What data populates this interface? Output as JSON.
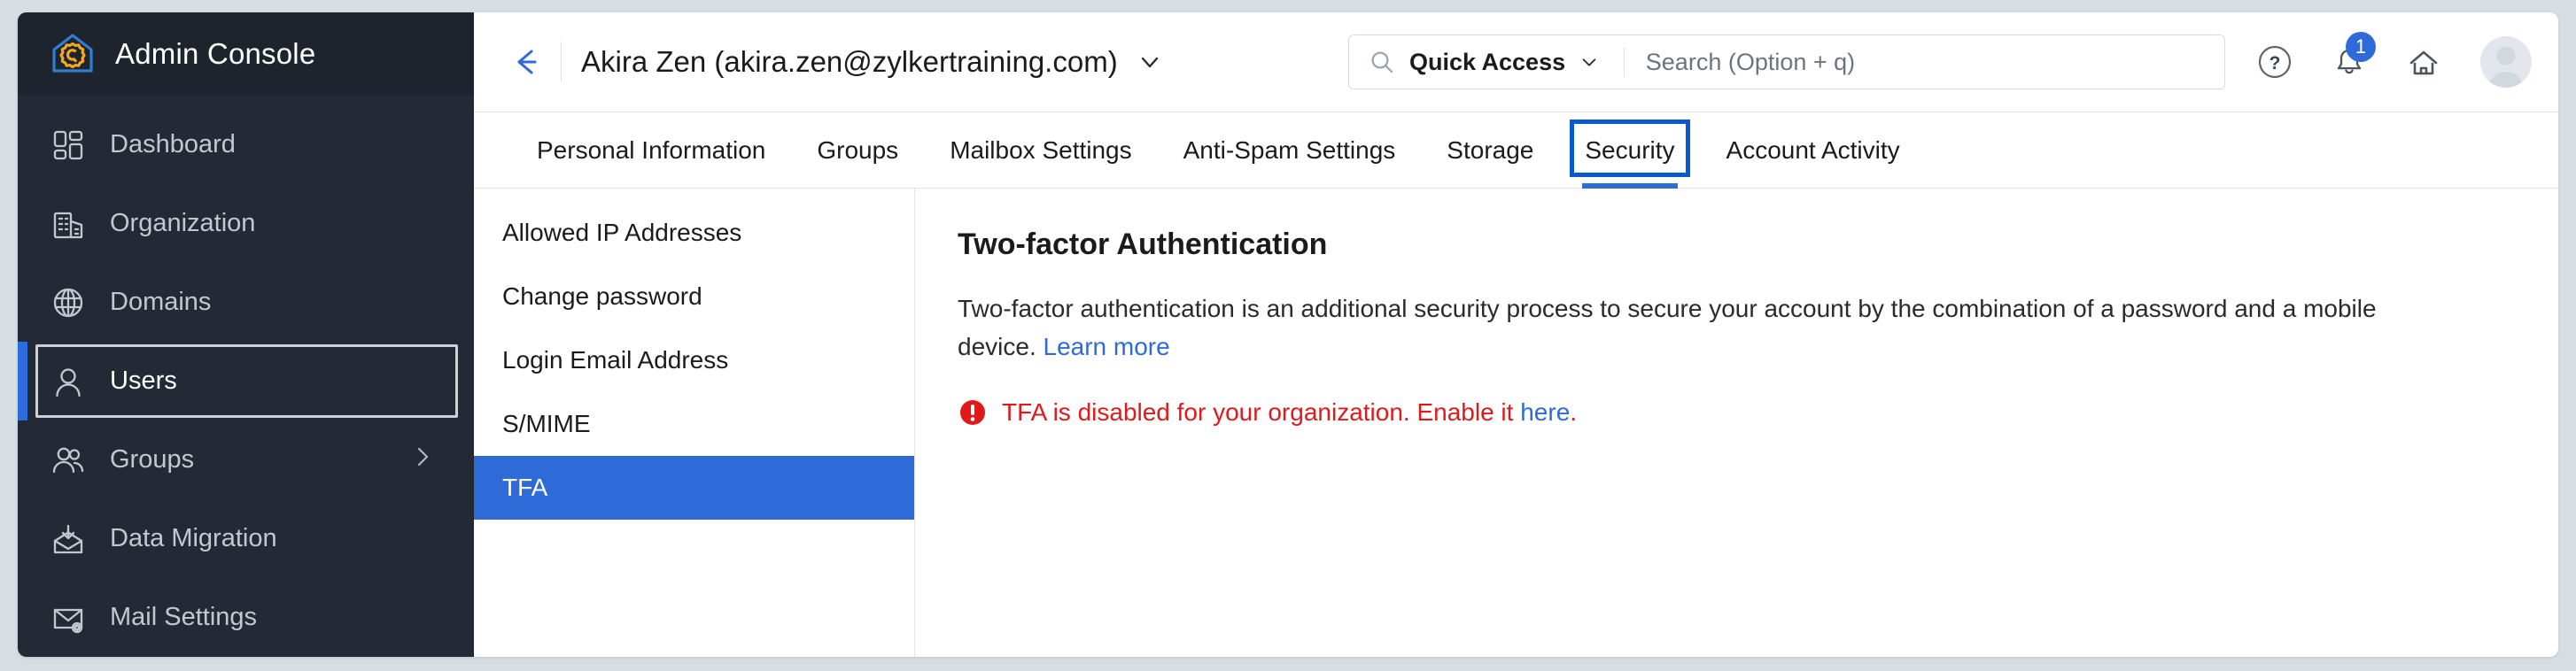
{
  "app": {
    "brand_title": "Admin Console",
    "brand_logo_icon": "house-gear-icon"
  },
  "sidebar": {
    "accent_color": "#2d6cdf",
    "background_color": "#242a35",
    "items": [
      {
        "label": "Dashboard",
        "icon": "grid-dashboard-icon",
        "selected": false,
        "has_chevron": false
      },
      {
        "label": "Organization",
        "icon": "building-icon",
        "selected": false,
        "has_chevron": false
      },
      {
        "label": "Domains",
        "icon": "globe-icon",
        "selected": false,
        "has_chevron": false
      },
      {
        "label": "Users",
        "icon": "user-icon",
        "selected": true,
        "has_chevron": false
      },
      {
        "label": "Groups",
        "icon": "users-group-icon",
        "selected": false,
        "has_chevron": true
      },
      {
        "label": "Data Migration",
        "icon": "envelope-download-icon",
        "selected": false,
        "has_chevron": false
      },
      {
        "label": "Mail Settings",
        "icon": "envelope-gear-icon",
        "selected": false,
        "has_chevron": false
      }
    ]
  },
  "topbar": {
    "back_icon": "arrow-left-icon",
    "account_title": "Akira Zen (akira.zen@zylkertraining.com)",
    "account_caret_icon": "chevron-down-icon",
    "search": {
      "search_icon": "search-icon",
      "quick_access_label": "Quick Access",
      "quick_access_caret_icon": "chevron-down-icon",
      "placeholder": "Search (Option + q)",
      "value": ""
    },
    "help_icon": "question-circle-icon",
    "notification_icon": "bell-icon",
    "notification_count": "1",
    "notification_badge_color": "#2f6ad9",
    "home_icon": "home-icon",
    "avatar_icon": "avatar-icon"
  },
  "tabs": {
    "active_color": "#2f6ad9",
    "items": [
      {
        "label": "Personal Information",
        "active": false
      },
      {
        "label": "Groups",
        "active": false
      },
      {
        "label": "Mailbox Settings",
        "active": false
      },
      {
        "label": "Anti-Spam Settings",
        "active": false
      },
      {
        "label": "Storage",
        "active": false
      },
      {
        "label": "Security",
        "active": true
      },
      {
        "label": "Account Activity",
        "active": false
      }
    ]
  },
  "subnav": {
    "active_color": "#2f6ad9",
    "items": [
      {
        "label": "Allowed IP Addresses",
        "active": false
      },
      {
        "label": "Change password",
        "active": false
      },
      {
        "label": "Login Email Address",
        "active": false
      },
      {
        "label": "S/MIME",
        "active": false
      },
      {
        "label": "TFA",
        "active": true
      }
    ]
  },
  "content": {
    "title": "Two-factor Authentication",
    "description_part1": "Two-factor authentication is an additional security process to secure your account by the combination of a password and a mobile device. ",
    "learn_more_label": "Learn more",
    "alert": {
      "icon": "error-exclamation-icon",
      "color": "#e01a1a",
      "text_part1": "TFA is disabled for your organization. Enable it ",
      "link_label": "here",
      "text_part2": "."
    }
  }
}
